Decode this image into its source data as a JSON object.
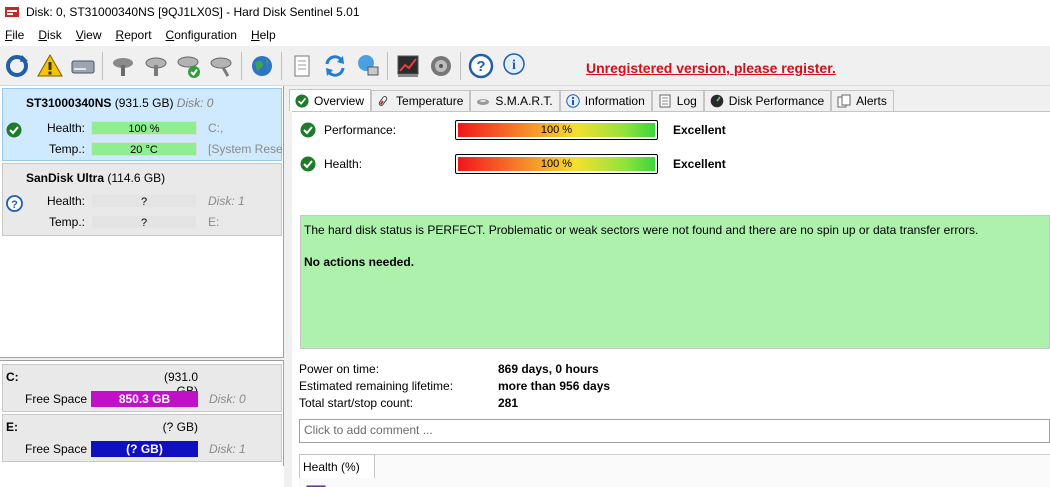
{
  "window": {
    "title": "Disk: 0, ST31000340NS [9QJ1LX0S]  -  Hard Disk Sentinel 5.01"
  },
  "menu": [
    {
      "ul": "F",
      "rest": "ile"
    },
    {
      "ul": "D",
      "rest": "isk"
    },
    {
      "ul": "V",
      "rest": "iew"
    },
    {
      "ul": "R",
      "rest": "eport"
    },
    {
      "ul": "C",
      "rest": "onfiguration"
    },
    {
      "ul": "H",
      "rest": "elp"
    }
  ],
  "toolbar": {
    "register_text": "Unregistered version, please register.",
    "icons": [
      "refresh-icon",
      "alert-icon",
      "disk-drive-icon",
      "disk-tools-icon",
      "disk-test-icon",
      "disk-check-icon",
      "disk-repair-icon",
      "web-globe-icon",
      "report-icon",
      "sync-icon",
      "network-icon",
      "graph-icon",
      "speaker-icon",
      "help-icon",
      "info-icon"
    ]
  },
  "disks": [
    {
      "name": "ST31000340NS",
      "size": "(931.5 GB)",
      "disk_no": "Disk: 0",
      "health_label": "Health:",
      "health_value": "100 %",
      "health_side": "C:,",
      "temp_label": "Temp.:",
      "temp_value": "20 °C",
      "temp_side": "[System Rese",
      "status_icon": "check-circle-icon"
    },
    {
      "name": "SanDisk Ultra",
      "size": "(114.6 GB)",
      "health_label": "Health:",
      "health_value": "?",
      "health_side": "Disk: 1",
      "temp_label": "Temp.:",
      "temp_value": "?",
      "temp_side": "E:",
      "status_icon": "question-circle-icon"
    }
  ],
  "partitions": [
    {
      "letter": "C:",
      "size": "(931.0 GB)",
      "free_label": "Free Space",
      "free_value": "850.3 GB",
      "disk": "Disk: 0",
      "bar_color": "#c010c8"
    },
    {
      "letter": "E:",
      "size": "(? GB)",
      "free_label": "Free Space",
      "free_value": "(? GB)",
      "disk": "Disk: 1",
      "bar_color": "#1010c0"
    }
  ],
  "tabs": [
    {
      "label": "Overview",
      "icon": "check-circle-icon"
    },
    {
      "label": "Temperature",
      "icon": "thermometer-icon"
    },
    {
      "label": "S.M.A.R.T.",
      "icon": "smart-icon"
    },
    {
      "label": "Information",
      "icon": "info-icon"
    },
    {
      "label": "Log",
      "icon": "log-icon"
    },
    {
      "label": "Disk Performance",
      "icon": "performance-icon"
    },
    {
      "label": "Alerts",
      "icon": "alerts-icon"
    }
  ],
  "overview": {
    "performance": {
      "label": "Performance:",
      "value": "100 %",
      "rating": "Excellent",
      "percent": 100
    },
    "health": {
      "label": "Health:",
      "value": "100 %",
      "rating": "Excellent",
      "percent": 100
    },
    "status_text": "The hard disk status is PERFECT. Problematic or weak sectors were not found and there are no spin up or data transfer errors.",
    "action_text": "No actions needed.",
    "info": [
      {
        "key": "Power on time:",
        "value": "869 days, 0 hours"
      },
      {
        "key": "Estimated remaining lifetime:",
        "value": "more than 956 days"
      },
      {
        "key": "Total start/stop count:",
        "value": "281"
      }
    ],
    "comment_placeholder": "Click to add comment ...",
    "subtab": "Health (%)"
  },
  "colors": {
    "status_bg": "#adf1ad",
    "health_bar": "#90ee90",
    "register": "#d0101b",
    "selected_disk": "#cfeafe"
  }
}
